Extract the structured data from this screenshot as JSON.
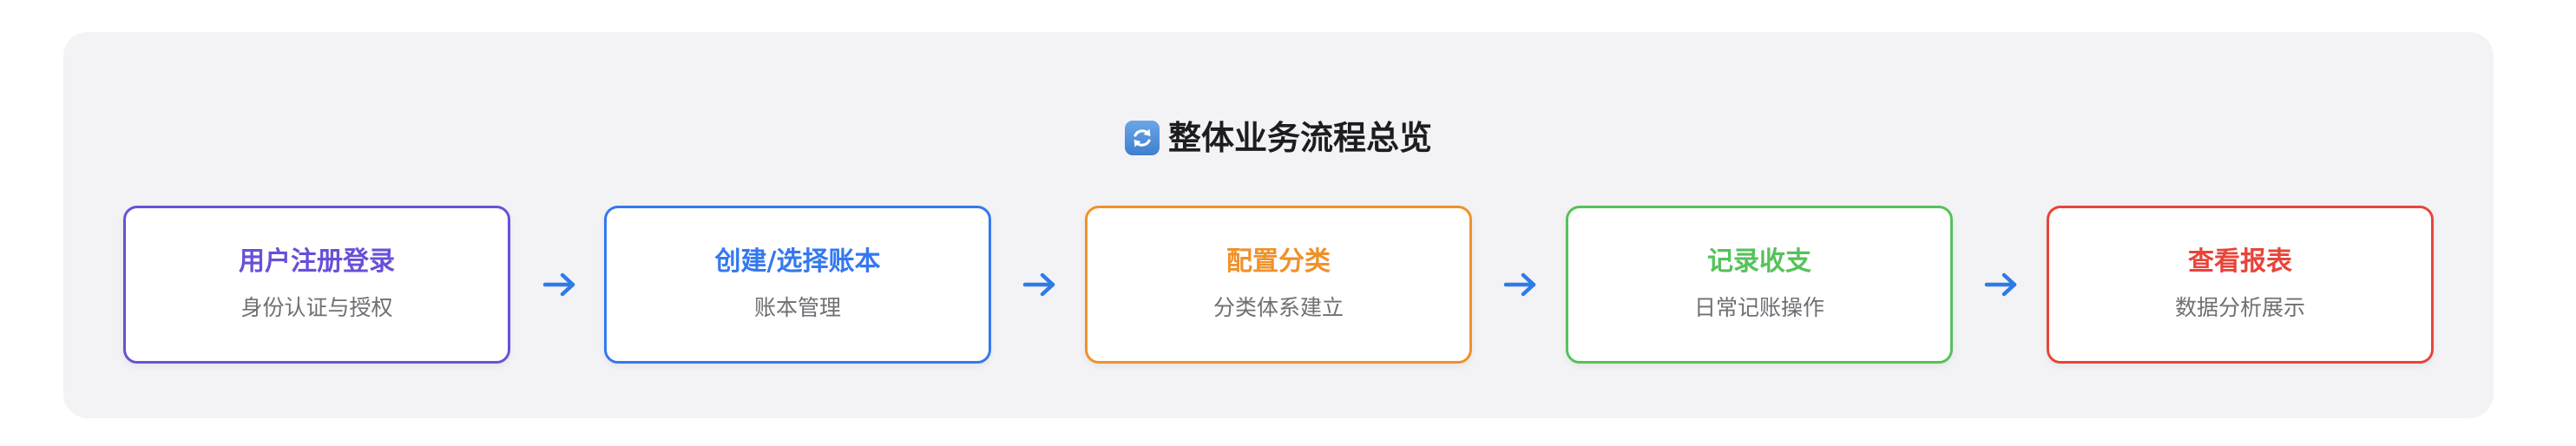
{
  "title": {
    "icon": "refresh-cycle-icon",
    "text": "整体业务流程总览"
  },
  "steps": [
    {
      "title": "用户注册登录",
      "subtitle": "身份认证与授权",
      "color": "#6a4fd8"
    },
    {
      "title": "创建/选择账本",
      "subtitle": "账本管理",
      "color": "#3478f0"
    },
    {
      "title": "配置分类",
      "subtitle": "分类体系建立",
      "color": "#f0912a"
    },
    {
      "title": "记录收支",
      "subtitle": "日常记账操作",
      "color": "#55c25a"
    },
    {
      "title": "查看报表",
      "subtitle": "数据分析展示",
      "color": "#e8443a"
    }
  ],
  "arrow_color": "#2f7be6"
}
